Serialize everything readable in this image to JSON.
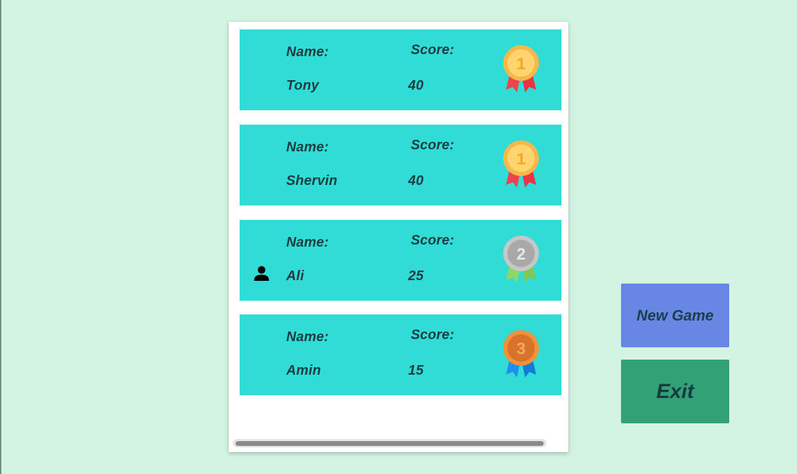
{
  "leaderboard": {
    "entries": [
      {
        "name_label": "Name:",
        "score_label": "Score:",
        "name": "Tony",
        "score": "40",
        "medal": "gold-medal-icon",
        "medal_number": "1",
        "current_user": false
      },
      {
        "name_label": "Name:",
        "score_label": "Score:",
        "name": "Shervin",
        "score": "40",
        "medal": "gold-medal-icon",
        "medal_number": "1",
        "current_user": false
      },
      {
        "name_label": "Name:",
        "score_label": "Score:",
        "name": "Ali",
        "score": "25",
        "medal": "silver-medal-icon",
        "medal_number": "2",
        "current_user": true
      },
      {
        "name_label": "Name:",
        "score_label": "Score:",
        "name": "Amin",
        "score": "15",
        "medal": "bronze-medal-icon",
        "medal_number": "3",
        "current_user": false
      }
    ]
  },
  "buttons": {
    "new_game": "New Game",
    "exit": "Exit"
  },
  "colors": {
    "background": "#d3f4e2",
    "card": "#30dcd6",
    "new_game": "#6688e4",
    "exit": "#33a176"
  }
}
